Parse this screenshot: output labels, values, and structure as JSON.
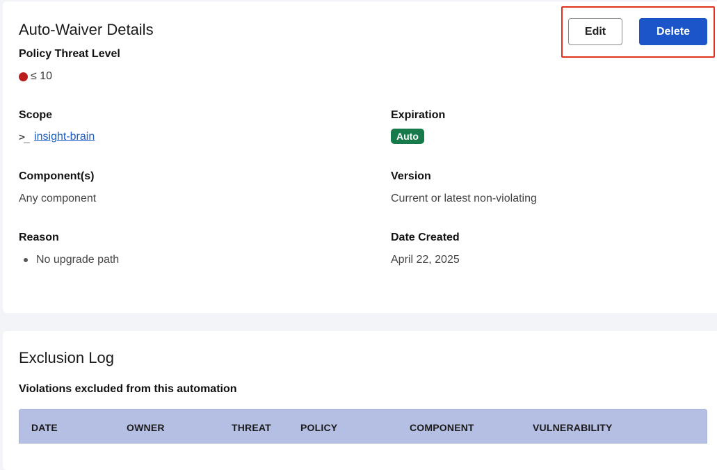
{
  "details": {
    "title": "Auto-Waiver Details",
    "threat_level_label": "Policy Threat Level",
    "threat_level_value": "≤ 10",
    "threat_color": "#bb1c1c",
    "scope_label": "Scope",
    "scope_icon": "terminal-icon",
    "scope_icon_glyph": ">_",
    "scope_value": "insight-brain",
    "expiration_label": "Expiration",
    "expiration_value": "Auto",
    "components_label": "Component(s)",
    "components_value": "Any component",
    "version_label": "Version",
    "version_value": "Current or latest non-violating",
    "reason_label": "Reason",
    "reasons": [
      "No upgrade path"
    ],
    "date_created_label": "Date Created",
    "date_created_value": "April 22, 2025"
  },
  "actions": {
    "edit_label": "Edit",
    "delete_label": "Delete",
    "delete_color": "#1b55c9",
    "highlight_color": "#e0321f"
  },
  "exclusion_log": {
    "title": "Exclusion Log",
    "subtitle": "Violations excluded from this automation",
    "columns": [
      "DATE",
      "OWNER",
      "THREAT",
      "POLICY",
      "COMPONENT",
      "VULNERABILITY"
    ]
  }
}
